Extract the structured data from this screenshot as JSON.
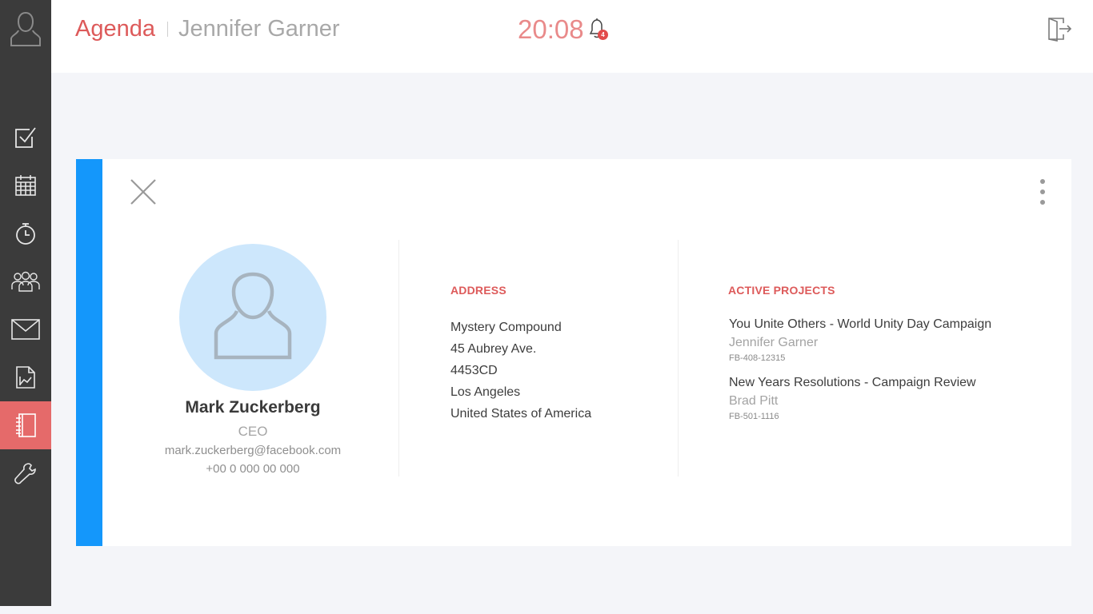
{
  "header": {
    "app_title": "Agenda",
    "user_name": "Jennifer Garner",
    "clock": "20:08",
    "notification_count": "4"
  },
  "sidebar": {
    "items": [
      {
        "icon": "checkbox-icon",
        "label": "Tasks"
      },
      {
        "icon": "calendar-icon",
        "label": "Calendar"
      },
      {
        "icon": "timer-icon",
        "label": "Timer"
      },
      {
        "icon": "team-icon",
        "label": "Team"
      },
      {
        "icon": "mail-icon",
        "label": "Mail"
      },
      {
        "icon": "report-icon",
        "label": "Reports"
      },
      {
        "icon": "address-book-icon",
        "label": "Address book",
        "active": true
      },
      {
        "icon": "wrench-icon",
        "label": "Settings"
      }
    ]
  },
  "contact": {
    "name": "Mark Zuckerberg",
    "role": "CEO",
    "email": "mark.zuckerberg@facebook.com",
    "phone": "+00 0 000 00 000"
  },
  "address": {
    "heading": "ADDRESS",
    "lines": [
      "Mystery Compound",
      "45 Aubrey Ave.",
      "4453CD",
      "Los Angeles",
      "United States of America"
    ]
  },
  "projects": {
    "heading": "ACTIVE PROJECTS",
    "items": [
      {
        "title": "You Unite Others - World Unity Day Campaign",
        "owner": "Jennifer Garner",
        "code": "FB-408-12315"
      },
      {
        "title": "New Years Resolutions - Campaign Review",
        "owner": "Brad Pitt",
        "code": "FB-501-1116"
      }
    ]
  },
  "colors": {
    "accent_red": "#dd5a5a",
    "accent_blue": "#1497fb",
    "sidebar_bg": "#3b3b3b",
    "avatar_bg": "#cde7fc"
  }
}
